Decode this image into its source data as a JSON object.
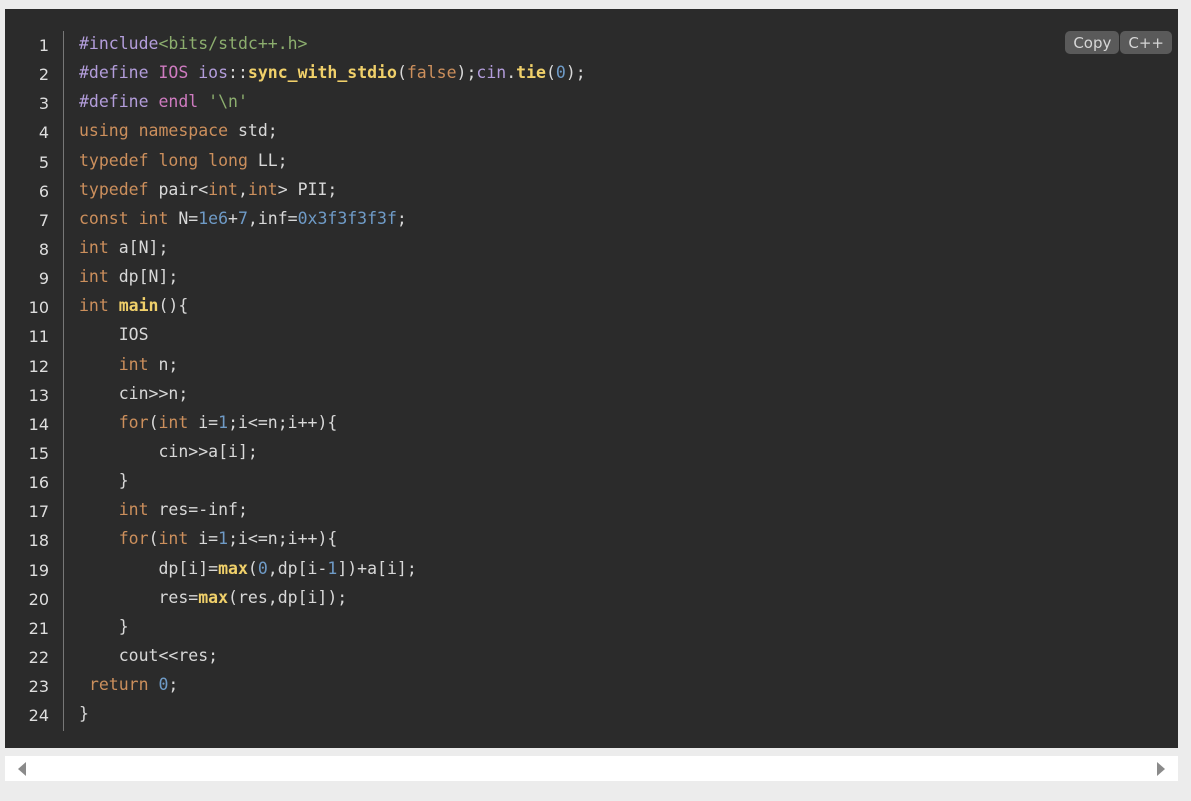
{
  "toolbar": {
    "copy_label": "Copy",
    "language_label": "C++"
  },
  "line_numbers": [
    "1",
    "2",
    "3",
    "4",
    "5",
    "6",
    "7",
    "8",
    "9",
    "10",
    "11",
    "12",
    "13",
    "14",
    "15",
    "16",
    "17",
    "18",
    "19",
    "20",
    "21",
    "22",
    "23",
    "24"
  ],
  "code_lines": [
    [
      [
        "pre",
        "#include"
      ],
      [
        "str",
        "<bits/stdc++.h>"
      ]
    ],
    [
      [
        "pre",
        "#define "
      ],
      [
        "mac",
        "IOS "
      ],
      [
        "pre",
        "ios"
      ],
      [
        "plain",
        "::"
      ],
      [
        "fn",
        "sync_with_stdio"
      ],
      [
        "plain",
        "("
      ],
      [
        "kw",
        "false"
      ],
      [
        "plain",
        ");"
      ],
      [
        "pre",
        "cin"
      ],
      [
        "plain",
        "."
      ],
      [
        "fn",
        "tie"
      ],
      [
        "plain",
        "("
      ],
      [
        "num",
        "0"
      ],
      [
        "plain",
        ");"
      ]
    ],
    [
      [
        "pre",
        "#define "
      ],
      [
        "mac",
        "endl "
      ],
      [
        "str",
        "'\\n'"
      ]
    ],
    [
      [
        "kw",
        "using namespace "
      ],
      [
        "plain",
        "std;"
      ]
    ],
    [
      [
        "kw",
        "typedef long long "
      ],
      [
        "plain",
        "LL;"
      ]
    ],
    [
      [
        "kw",
        "typedef "
      ],
      [
        "plain",
        "pair<"
      ],
      [
        "kw",
        "int"
      ],
      [
        "plain",
        ","
      ],
      [
        "kw",
        "int"
      ],
      [
        "plain",
        "> PII;"
      ]
    ],
    [
      [
        "kw",
        "const int "
      ],
      [
        "plain",
        "N="
      ],
      [
        "num",
        "1e6"
      ],
      [
        "plain",
        "+"
      ],
      [
        "num",
        "7"
      ],
      [
        "plain",
        ",inf="
      ],
      [
        "num",
        "0x3f3f3f3f"
      ],
      [
        "plain",
        ";"
      ]
    ],
    [
      [
        "kw",
        "int "
      ],
      [
        "plain",
        "a[N];"
      ]
    ],
    [
      [
        "kw",
        "int "
      ],
      [
        "plain",
        "dp[N];"
      ]
    ],
    [
      [
        "kw",
        "int "
      ],
      [
        "fn",
        "main"
      ],
      [
        "plain",
        "(){"
      ]
    ],
    [
      [
        "plain",
        "    IOS"
      ]
    ],
    [
      [
        "plain",
        "    "
      ],
      [
        "kw",
        "int "
      ],
      [
        "plain",
        "n;"
      ]
    ],
    [
      [
        "plain",
        "    cin>>n;"
      ]
    ],
    [
      [
        "plain",
        "    "
      ],
      [
        "kw",
        "for"
      ],
      [
        "plain",
        "("
      ],
      [
        "kw",
        "int "
      ],
      [
        "plain",
        "i="
      ],
      [
        "num",
        "1"
      ],
      [
        "plain",
        ";i<=n;i++){"
      ]
    ],
    [
      [
        "plain",
        "        cin>>a[i];"
      ]
    ],
    [
      [
        "plain",
        "    }"
      ]
    ],
    [
      [
        "plain",
        "    "
      ],
      [
        "kw",
        "int "
      ],
      [
        "plain",
        "res=-inf;"
      ]
    ],
    [
      [
        "plain",
        "    "
      ],
      [
        "kw",
        "for"
      ],
      [
        "plain",
        "("
      ],
      [
        "kw",
        "int "
      ],
      [
        "plain",
        "i="
      ],
      [
        "num",
        "1"
      ],
      [
        "plain",
        ";i<=n;i++){"
      ]
    ],
    [
      [
        "plain",
        "        dp[i]="
      ],
      [
        "fn",
        "max"
      ],
      [
        "plain",
        "("
      ],
      [
        "num",
        "0"
      ],
      [
        "plain",
        ",dp[i-"
      ],
      [
        "num",
        "1"
      ],
      [
        "plain",
        "])+a[i];"
      ]
    ],
    [
      [
        "plain",
        "        res="
      ],
      [
        "fn",
        "max"
      ],
      [
        "plain",
        "(res,dp[i]);"
      ]
    ],
    [
      [
        "plain",
        "    }"
      ]
    ],
    [
      [
        "plain",
        "    cout<<res;"
      ]
    ],
    [
      [
        "plain",
        " "
      ],
      [
        "kw",
        "return "
      ],
      [
        "num",
        "0"
      ],
      [
        "plain",
        ";"
      ]
    ],
    [
      [
        "plain",
        "}"
      ]
    ]
  ]
}
